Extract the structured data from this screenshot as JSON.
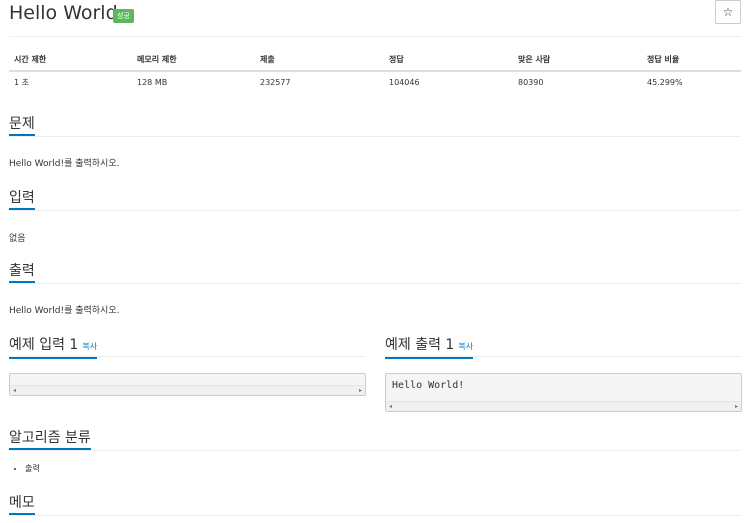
{
  "problem": {
    "title": "Hello World",
    "status_badge": "성공",
    "star_icon": "☆"
  },
  "info_table": {
    "headers": [
      "시간 제한",
      "메모리 제한",
      "제출",
      "정답",
      "맞은 사람",
      "정답 비율"
    ],
    "values": [
      "1 초",
      "128 MB",
      "232577",
      "104046",
      "80390",
      "45.299%"
    ]
  },
  "sections": {
    "problem": {
      "heading": "문제",
      "text": "Hello World!를 출력하시오."
    },
    "input": {
      "heading": "입력",
      "text": "없음"
    },
    "output": {
      "heading": "출력",
      "text": "Hello World!를 출력하시오."
    },
    "sample_input": {
      "heading": "예제 입력 1",
      "copy": "복사",
      "content": ""
    },
    "sample_output": {
      "heading": "예제 출력 1",
      "copy": "복사",
      "content": "Hello World!"
    },
    "algorithm": {
      "heading": "알고리즘 분류",
      "tags": [
        "출력"
      ]
    },
    "memo": {
      "heading": "메모"
    }
  },
  "colors": {
    "accent": "#0076c0",
    "badge": "#5cb85c"
  }
}
